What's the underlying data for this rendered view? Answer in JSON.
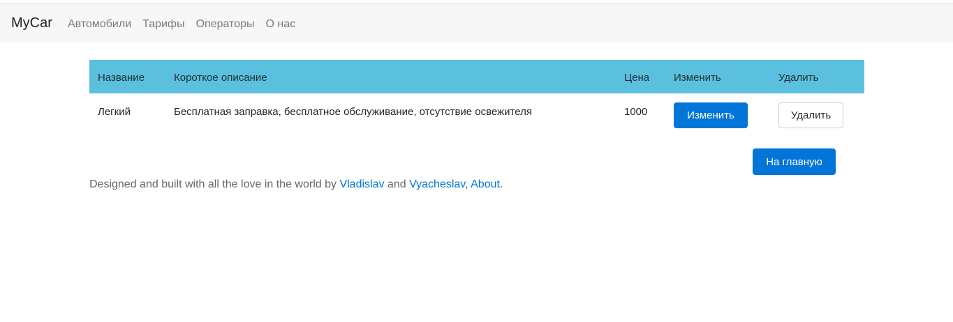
{
  "navbar": {
    "brand": "MyCar",
    "links": [
      "Автомобили",
      "Тарифы",
      "Операторы",
      "О нас"
    ]
  },
  "table": {
    "headers": [
      "Название",
      "Короткое описание",
      "Цена",
      "Изменить",
      "Удалить"
    ],
    "rows": [
      {
        "name": "Легкий",
        "description": "Бесплатная заправка, бесплатное обслуживание, отсутствие освежителя",
        "price": "1000",
        "edit_label": "Изменить",
        "delete_label": "Удалить"
      }
    ]
  },
  "home_button": "На главную",
  "footer": {
    "prefix": "Designed and built with all the love in the world by ",
    "author1": "Vladislav",
    "and": " and ",
    "author2": "Vyacheslav",
    "comma": ", ",
    "about": "About."
  },
  "colors": {
    "header_bg": "#5bc0de",
    "navbar_bg": "#f7f7f7",
    "primary": "#0275d8"
  }
}
